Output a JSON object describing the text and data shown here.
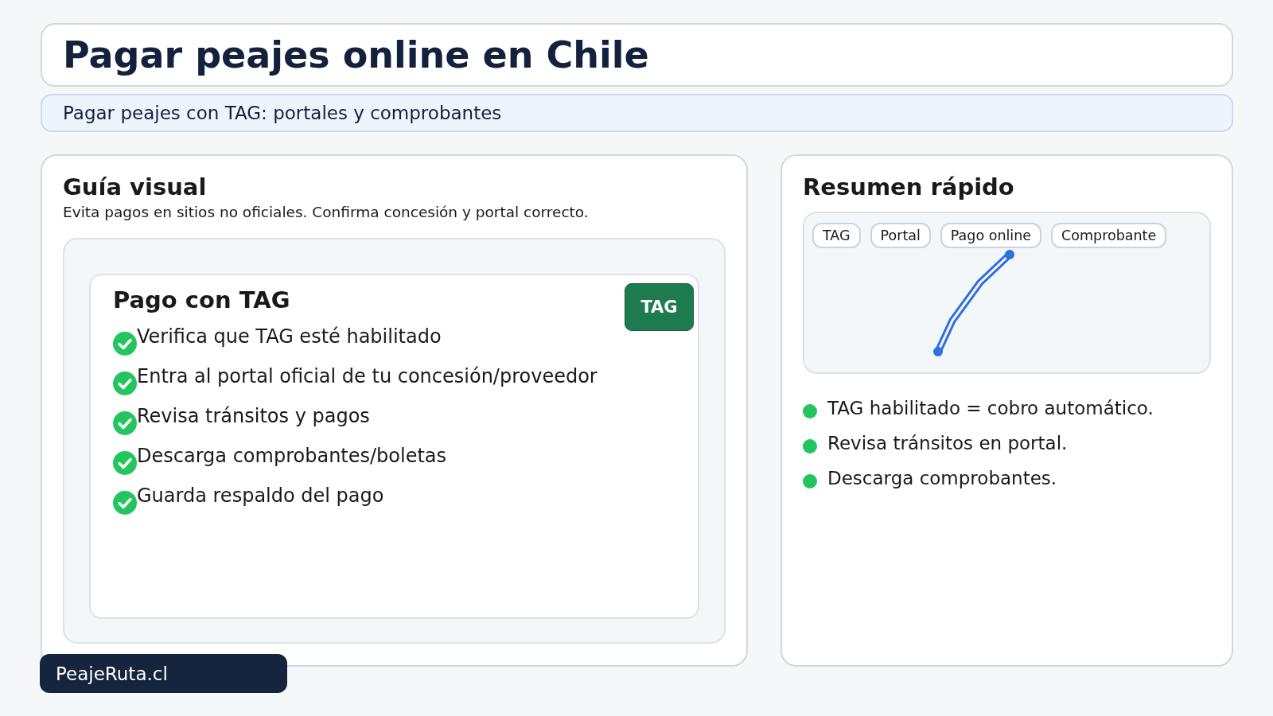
{
  "header": {
    "title": "Pagar peajes online en Chile",
    "subtitle": "Pagar peajes con TAG: portales y comprobantes"
  },
  "guide": {
    "title": "Guía visual",
    "note": "Evita pagos en sitios no oficiales. Confirma concesión y portal correcto.",
    "card": {
      "title": "Pago con TAG",
      "badge": "TAG",
      "steps": [
        {
          "text": "Verifica que TAG esté habilitado",
          "checked": true
        },
        {
          "text": "Entra al portal oficial de tu concesión/proveedor",
          "checked": true
        },
        {
          "text": "Revisa tránsitos y pagos",
          "checked": true
        },
        {
          "text": "Descarga comprobantes/boletas",
          "checked": true
        },
        {
          "text": "Guarda respaldo del pago",
          "checked": true
        }
      ]
    }
  },
  "summary": {
    "title": "Resumen rápido",
    "chips": [
      "TAG",
      "Portal",
      "Pago online",
      "Comprobante"
    ],
    "points": [
      {
        "text": "TAG habilitado = cobro automático.",
        "color": "#22c55e"
      },
      {
        "text": "Revisa tránsitos en portal.",
        "color": "#22c55e"
      },
      {
        "text": "Descarga comprobantes.",
        "color": "#22c55e"
      }
    ]
  },
  "footer": {
    "brand": "PeajeRuta.cl"
  }
}
